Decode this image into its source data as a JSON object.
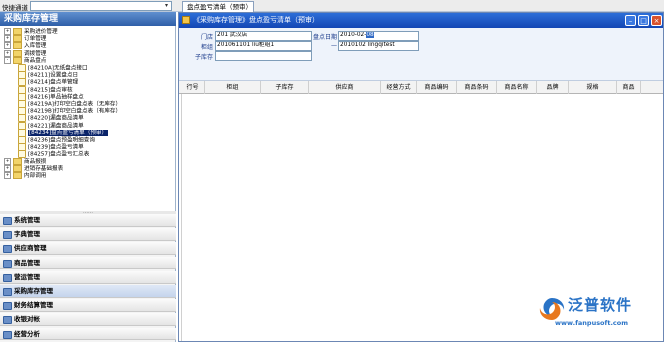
{
  "topbar": {
    "quick_label": "快捷通道",
    "tab_label": "盘点盈亏清单（预审）"
  },
  "left": {
    "title": "采购库存管理",
    "tree": [
      {
        "label": "采购进价管理",
        "kind": "folder",
        "pm": "+"
      },
      {
        "label": "订单管理",
        "kind": "folder",
        "pm": "+"
      },
      {
        "label": "入库管理",
        "kind": "folder",
        "pm": "+"
      },
      {
        "label": "调拨管理",
        "kind": "folder",
        "pm": "+"
      },
      {
        "label": "商品盘点",
        "kind": "folder",
        "pm": "-"
      },
      {
        "label": "[84210A]无纸盘点接口",
        "kind": "doc"
      },
      {
        "label": "[84211]设置盘点日",
        "kind": "doc"
      },
      {
        "label": "[84214]盘点单管理",
        "kind": "doc"
      },
      {
        "label": "[84215]盘点审核",
        "kind": "doc"
      },
      {
        "label": "[84216]单品抽样盘点",
        "kind": "doc"
      },
      {
        "label": "[84219A]打印空白盘点表（无库存）",
        "kind": "doc"
      },
      {
        "label": "[84219B]打印空白盘点表（有库存）",
        "kind": "doc"
      },
      {
        "label": "[84220]漏盘商品清单",
        "kind": "doc"
      },
      {
        "label": "[84221]漏盘商品清单",
        "kind": "doc"
      },
      {
        "label": "[84234]盘点盈亏清单（预审）",
        "kind": "doc",
        "selected": true
      },
      {
        "label": "[84236]盘点预盈明细查询",
        "kind": "doc"
      },
      {
        "label": "[84239]盘点盈亏清单",
        "kind": "doc"
      },
      {
        "label": "[84257]盘点盈亏汇总表",
        "kind": "doc"
      },
      {
        "label": "商品报损",
        "kind": "folder",
        "pm": "+"
      },
      {
        "label": "进销存基础报表",
        "kind": "folder",
        "pm": "+"
      },
      {
        "label": "内部调用",
        "kind": "folder",
        "pm": "+"
      }
    ],
    "nav": [
      {
        "label": "系统管理"
      },
      {
        "label": "字典管理"
      },
      {
        "label": "供应商管理"
      },
      {
        "label": "商品管理"
      },
      {
        "label": "营运管理"
      },
      {
        "label": "采购库存管理",
        "active": true
      },
      {
        "label": "财务结算管理"
      },
      {
        "label": "收银对帐"
      },
      {
        "label": "经营分析"
      }
    ]
  },
  "window": {
    "title": "《采购库存管理》盘点盈亏清单（预审）",
    "form": {
      "store_label": "门店",
      "store_value": "201 武汉店",
      "shelf_label": "柜组",
      "shelf_value": "201061101 liu柜组1",
      "sub_label": "子库存",
      "sub_value": "",
      "date_label": "盘点日期",
      "date_value": "2010-02-",
      "date_sel": "08",
      "sep": "—",
      "batch_value": "2010102 lingqitest"
    },
    "columns": [
      "行号",
      "柜组",
      "子库存",
      "供应商",
      "经营方式",
      "商品编码",
      "商品条码",
      "商品名称",
      "品牌",
      "规格",
      "商品"
    ]
  },
  "logo": {
    "text": "泛普软件",
    "url": "www.fanpusoft.com",
    "brand_color": "#2a73c6"
  }
}
